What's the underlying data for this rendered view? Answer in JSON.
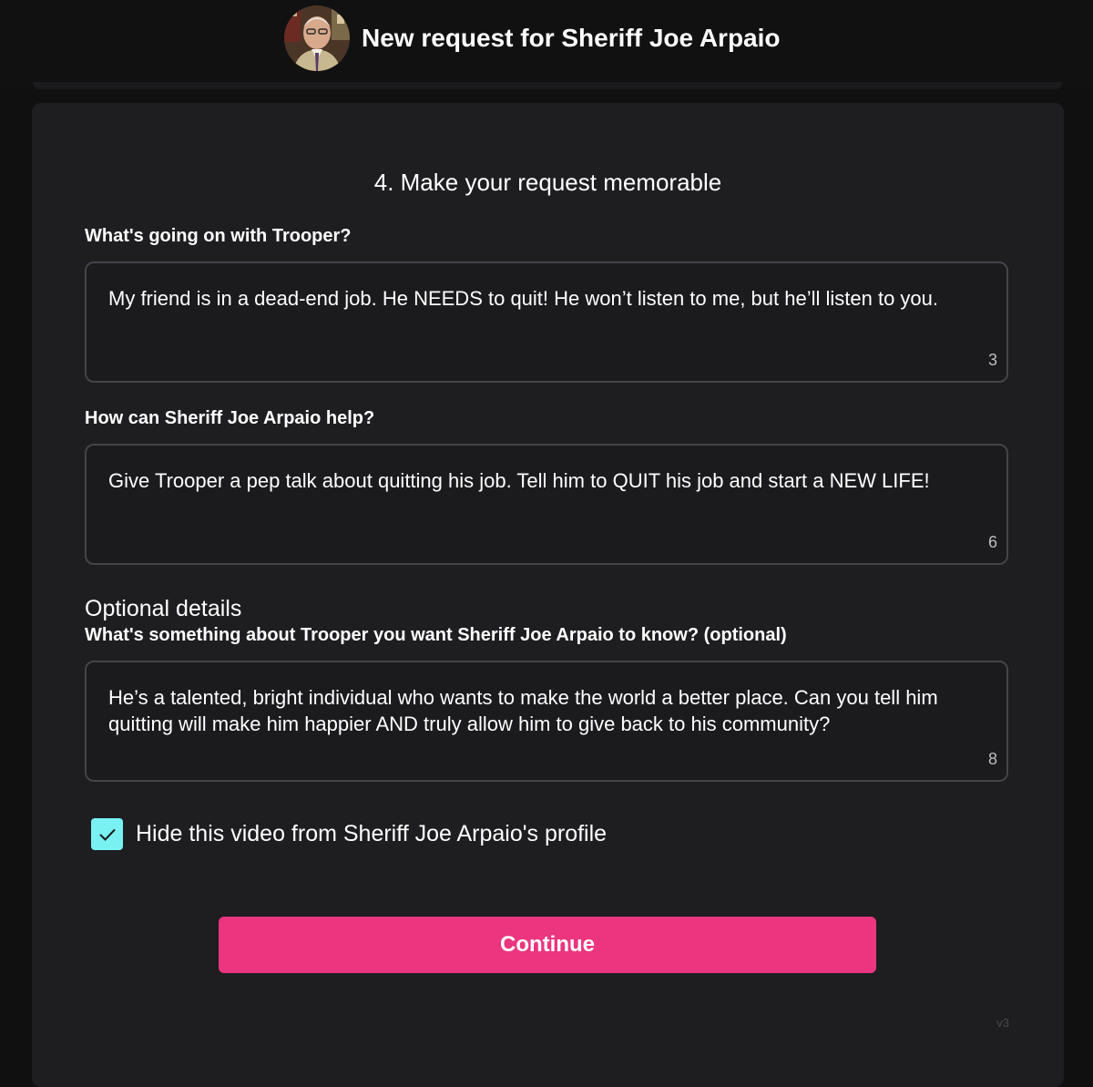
{
  "header": {
    "title": "New request for Sheriff Joe Arpaio",
    "avatar_icon": "celebrity-avatar"
  },
  "form": {
    "step_title": "4. Make your request memorable",
    "fields": [
      {
        "label": "What's going on with Trooper?",
        "value": "My friend is in a dead-end job. He NEEDS to quit! He won’t listen to me, but he’ll listen to you.",
        "counter": "3"
      },
      {
        "label": "How can Sheriff Joe Arpaio help?",
        "value": "Give Trooper a pep talk about quitting his job. Tell him to QUIT his job and start a NEW LIFE!",
        "counter": "6"
      }
    ],
    "optional": {
      "section_title": "Optional details",
      "label": "What's something about Trooper you want Sheriff Joe Arpaio to know? (optional)",
      "value": "He’s a talented, bright individual who wants to make the world a better place. Can you tell him quitting will make him happier AND truly allow him to give back to his community?",
      "counter": "8"
    },
    "hide_video": {
      "label": "Hide this video from Sheriff Joe Arpaio's profile",
      "checked": true
    },
    "continue_label": "Continue",
    "version": "v3"
  },
  "colors": {
    "accent_pink": "#eb357e",
    "checkbox_cyan": "#79f0f2",
    "card_bg": "#1e1d20",
    "page_bg": "#101010"
  }
}
